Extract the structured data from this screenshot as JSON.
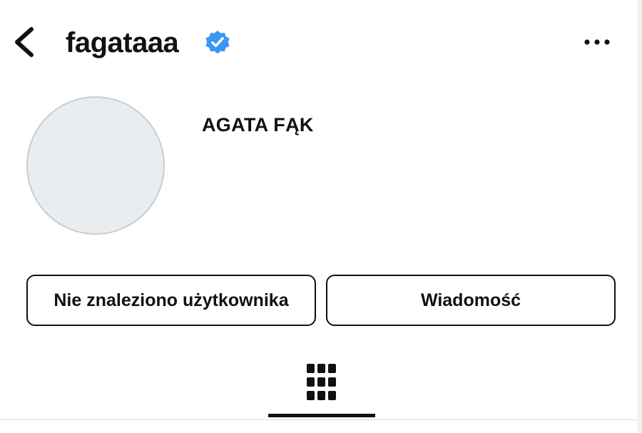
{
  "header": {
    "back_icon": "chevron-left-icon",
    "username": "fagataaa",
    "verified_icon": "verified-badge-icon",
    "verified_color": "#3897f0",
    "more_icon": "more-horizontal-icon"
  },
  "profile": {
    "avatar": "empty-avatar-placeholder",
    "display_name": "AGATA FĄK"
  },
  "actions": {
    "primary_label": "Nie znaleziono użytkownika",
    "message_label": "Wiadomość"
  },
  "tabs": {
    "grid_icon": "grid-icon",
    "active": "grid"
  }
}
